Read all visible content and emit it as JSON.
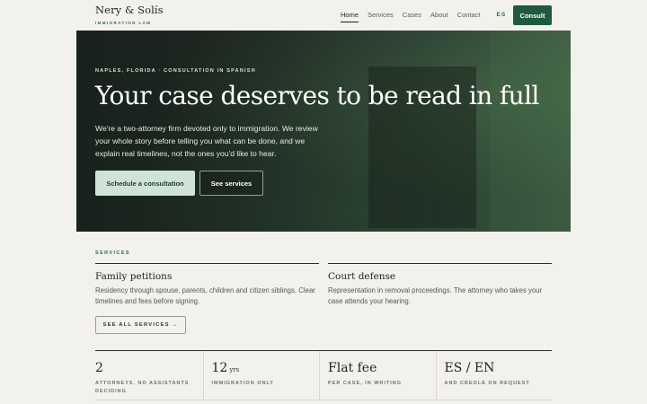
{
  "brand": {
    "name": "Nery & Solís",
    "subtitle": "IMMIGRATION LAW"
  },
  "nav": {
    "items": [
      "Home",
      "Services",
      "Cases",
      "About",
      "Contact"
    ],
    "language": "ES",
    "consult_label": "Consult"
  },
  "hero": {
    "eyebrow": "NAPLES, FLORIDA · CONSULTATION IN SPANISH",
    "title": "Your case deserves to be read in full",
    "text": "We're a two-attorney firm devoted only to immigration. We review your whole story before telling you what can be done, and we explain real timelines, not the ones you'd like to hear.",
    "primary_button": "Schedule a consultation",
    "secondary_button": "See services"
  },
  "services": {
    "label": "SERVICES",
    "items": [
      {
        "title": "Family petitions",
        "desc": "Residency through spouse, parents, children and citizen siblings. Clear timelines and fees before signing."
      },
      {
        "title": "Court defense",
        "desc": "Representation in removal proceedings. The attorney who takes your case attends your hearing."
      }
    ],
    "all_label": "SEE ALL SERVICES →"
  },
  "stats": [
    {
      "value": "2",
      "unit": "",
      "label": "ATTORNEYS, NO ASSISTANTS DECIDING"
    },
    {
      "value": "12",
      "unit": "yrs",
      "label": "IMMIGRATION ONLY"
    },
    {
      "value": "Flat fee",
      "unit": "",
      "label": "PER CASE, IN WRITING"
    },
    {
      "value": "ES / EN",
      "unit": "",
      "label": "AND CREOLE ON REQUEST"
    }
  ]
}
